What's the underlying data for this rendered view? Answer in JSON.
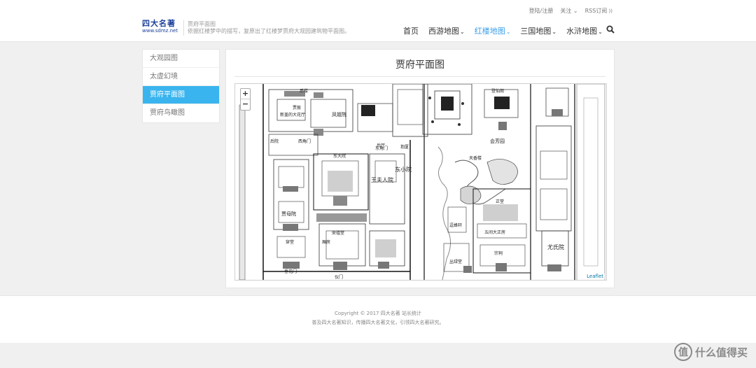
{
  "header": {
    "logo_text": "四大名著",
    "logo_url": "www.sdmz.net",
    "page_name": "贾府平面图",
    "page_desc": "依据红楼梦中的描写，复原出了红楼梦贾府大观园建筑物平面图。",
    "top_links": [
      "登陆/注册",
      "关注",
      "RSS订阅"
    ]
  },
  "nav": {
    "items": [
      {
        "label": "首页",
        "has_menu": false
      },
      {
        "label": "西游地图",
        "has_menu": true
      },
      {
        "label": "红楼地图",
        "has_menu": true
      },
      {
        "label": "三国地图",
        "has_menu": true
      },
      {
        "label": "水浒地图",
        "has_menu": true
      }
    ],
    "active_index": 2,
    "search_icon": "search-icon"
  },
  "sidebar": {
    "items": [
      "大观园图",
      "太虚幻境",
      "贾府平面图",
      "贾府鸟瞰图"
    ],
    "active_index": 2
  },
  "content": {
    "title": "贾府平面图",
    "zoom_in": "+",
    "zoom_out": "−",
    "attribution": "Leaflet",
    "map_labels": [
      "后楼",
      "贾赦",
      "凤姐院",
      "新盖的大花厅",
      "东小院",
      "王夫人院",
      "贾母院",
      "荣禧堂",
      "东大院",
      "五间大正房",
      "穿堂",
      "垂花门",
      "仪门",
      "会芳园",
      "天香楼",
      "正堂",
      "尤氏院",
      "宗祠",
      "登仙阁",
      "逗蜂轩",
      "丛绿堂",
      "后院",
      "西角门",
      "东角门",
      "抱厦",
      "厢房",
      "后厅"
    ]
  },
  "footer": {
    "copyright": "Copyright © 2017 四大名著 站长统计",
    "desc": "普及四大名著知识，传播四大名著文化，引领四大名著研究。"
  },
  "watermark": {
    "icon": "值",
    "text": "什么值得买"
  },
  "colors": {
    "accent": "#3ab4ee",
    "nav_active": "#3a9ee8",
    "bg": "#f0f0f0"
  }
}
